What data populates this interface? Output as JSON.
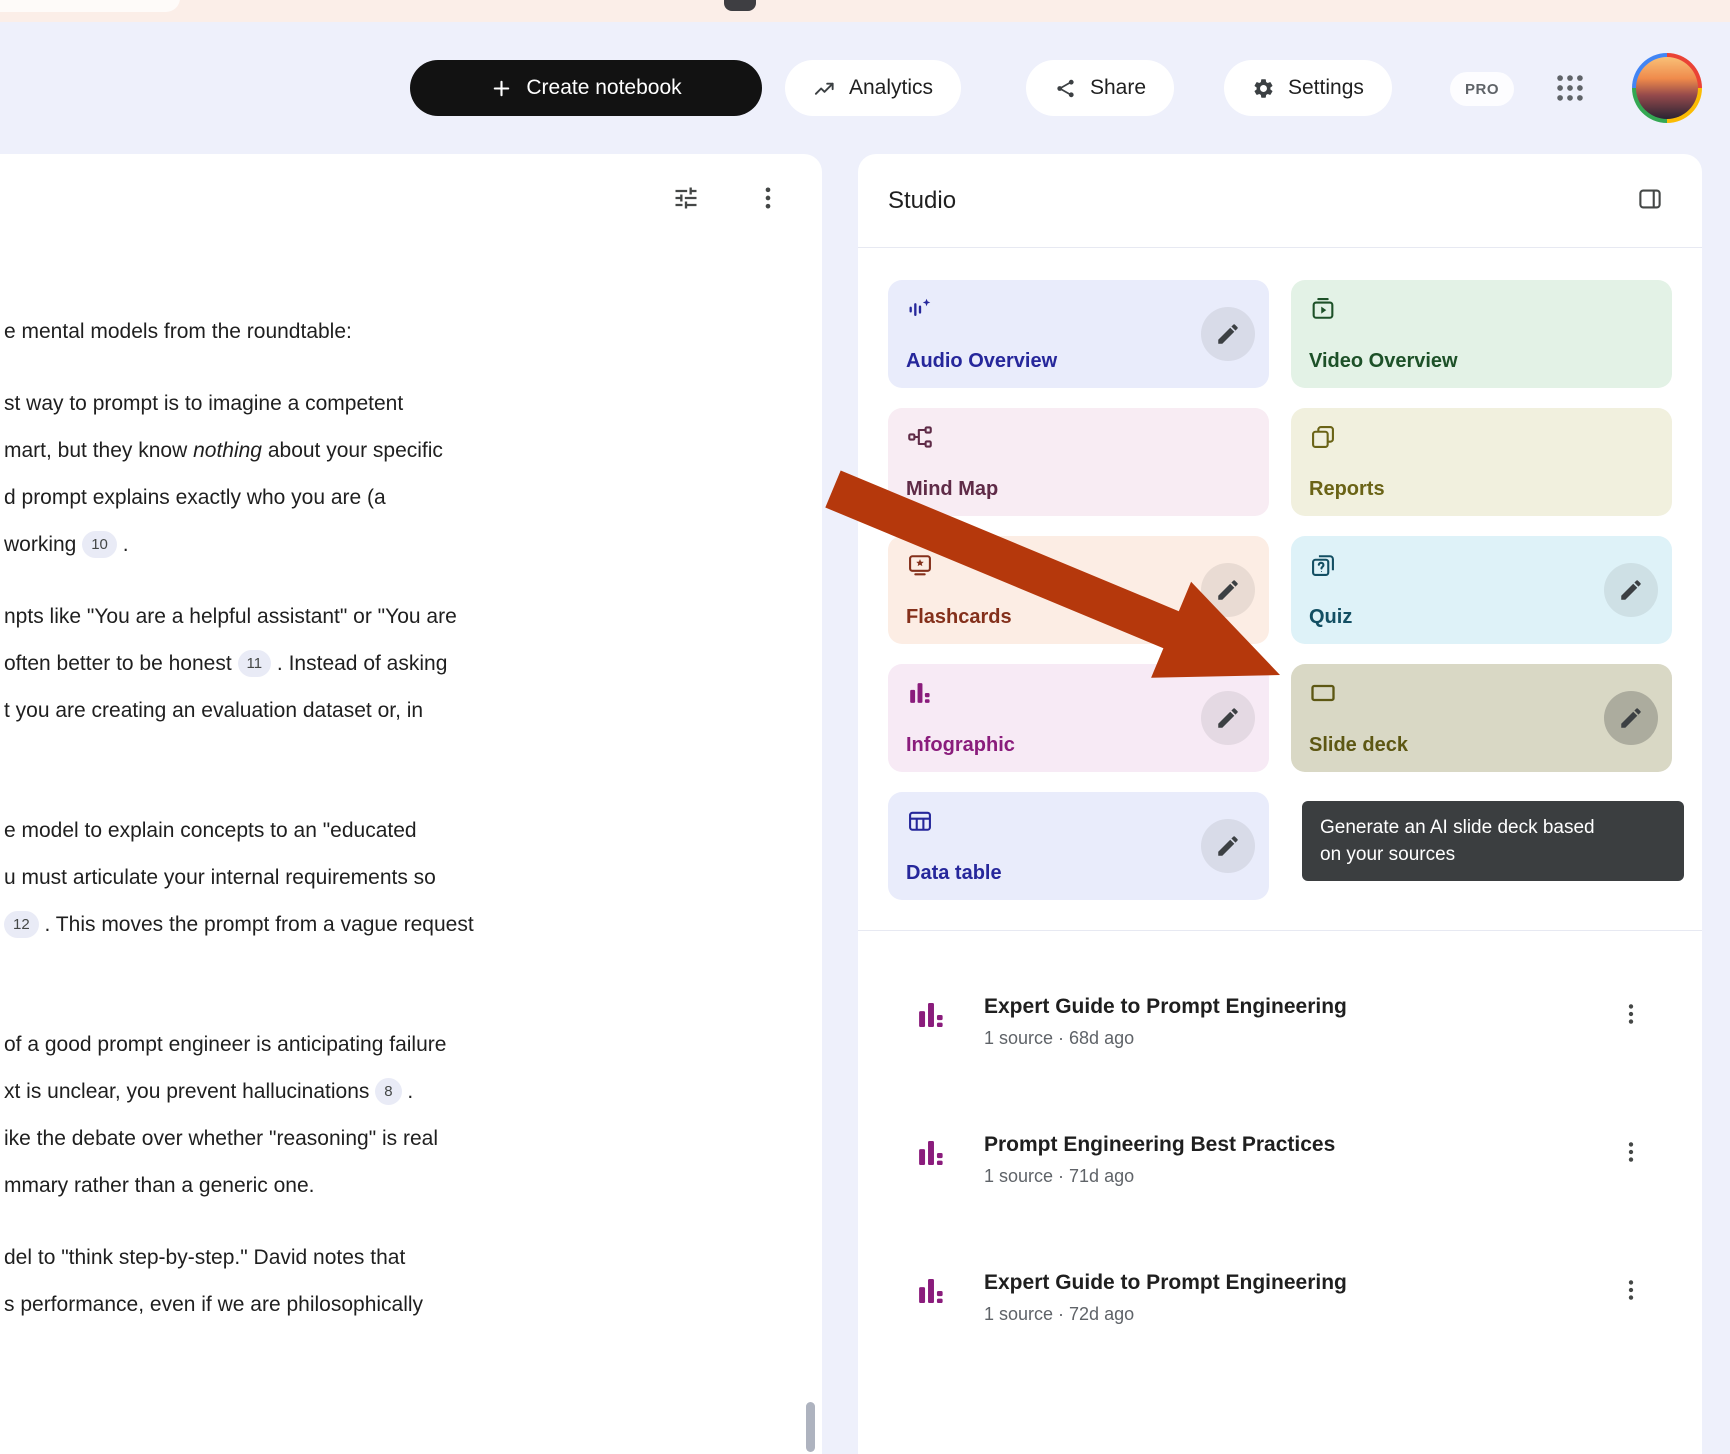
{
  "colors": {
    "page_bg": "#eef0fb",
    "top_strip": "#fbeee8",
    "create_button_bg": "#121212",
    "tooltip_bg": "#3b3e40",
    "list_icon_purple": "#8a1c7c"
  },
  "annotations": {
    "arrow_color": "#b5380c"
  },
  "header": {
    "create_button": "Create notebook",
    "analytics_button": "Analytics",
    "share_button": "Share",
    "settings_button": "Settings",
    "pro_badge": "PRO"
  },
  "document": {
    "paragraphs": [
      {
        "gap": "normal",
        "lines": [
          [
            {
              "type": "text",
              "text": "e mental models from the roundtable:"
            }
          ]
        ]
      },
      {
        "gap": "normal",
        "lines": [
          [
            {
              "type": "text",
              "text": "st way to prompt is to imagine a competent"
            }
          ],
          [
            {
              "type": "text",
              "text": "mart, but they know "
            },
            {
              "type": "italic",
              "text": "nothing"
            },
            {
              "type": "text",
              "text": " about your specific"
            }
          ],
          [
            {
              "type": "text",
              "text": "d prompt explains exactly who you are (a"
            }
          ],
          [
            {
              "type": "text",
              "text": "working "
            },
            {
              "type": "badge",
              "text": "10"
            },
            {
              "type": "text",
              "text": " ."
            }
          ]
        ]
      },
      {
        "gap": "large",
        "lines": [
          [
            {
              "type": "text",
              "text": "npts like \"You are a helpful assistant\" or \"You are"
            }
          ],
          [
            {
              "type": "text",
              "text": "often better to be honest "
            },
            {
              "type": "badge",
              "text": "11"
            },
            {
              "type": "text",
              "text": " . Instead of asking"
            }
          ],
          [
            {
              "type": "text",
              "text": "t you are creating an evaluation dataset or, in"
            }
          ]
        ]
      },
      {
        "gap": "large",
        "lines": [
          [
            {
              "type": "text",
              "text": "e model to explain concepts to an \"educated"
            }
          ],
          [
            {
              "type": "text",
              "text": "u must articulate your internal requirements so"
            }
          ],
          [
            {
              "type": "badge",
              "text": "12"
            },
            {
              "type": "text",
              "text": " . This moves the prompt from a vague request"
            }
          ]
        ]
      },
      {
        "gap": "normal",
        "lines": [
          [
            {
              "type": "text",
              "text": "of a good prompt engineer is anticipating failure"
            }
          ],
          [
            {
              "type": "text",
              "text": "xt is unclear, you prevent hallucinations "
            },
            {
              "type": "badge",
              "text": "8"
            },
            {
              "type": "text",
              "text": " ."
            }
          ],
          [
            {
              "type": "text",
              "text": "ike the debate over whether \"reasoning\" is real"
            }
          ],
          [
            {
              "type": "text",
              "text": "mmary rather than a generic one."
            }
          ]
        ]
      },
      {
        "gap": "normal",
        "lines": [
          [
            {
              "type": "text",
              "text": "del to \"think step-by-step.\" David notes that"
            }
          ],
          [
            {
              "type": "text",
              "text": "s performance, even if we are philosophically"
            }
          ]
        ]
      }
    ]
  },
  "studio": {
    "title": "Studio",
    "cards": [
      {
        "label": "Audio Overview",
        "icon": "audio-waveform-icon",
        "bg": "#e9ecfb",
        "fg": "#26279b",
        "edit": true
      },
      {
        "label": "Video Overview",
        "icon": "video-overview-icon",
        "bg": "#e3f2e6",
        "fg": "#1d5128",
        "edit": false
      },
      {
        "label": "Mind Map",
        "icon": "mind-map-icon",
        "bg": "#f8ecf3",
        "fg": "#5f2b47",
        "edit": false
      },
      {
        "label": "Reports",
        "icon": "reports-icon",
        "bg": "#f1f0de",
        "fg": "#6a6316",
        "edit": false
      },
      {
        "label": "Flashcards",
        "icon": "flashcards-icon",
        "bg": "#fcede4",
        "fg": "#84301b",
        "edit": true
      },
      {
        "label": "Quiz",
        "icon": "quiz-icon",
        "bg": "#def2f8",
        "fg": "#134f63",
        "edit": true
      },
      {
        "label": "Infographic",
        "icon": "infographic-icon",
        "bg": "#f7eaf5",
        "fg": "#8a1c7c",
        "edit": true
      },
      {
        "label": "Slide deck",
        "icon": "slide-deck-icon",
        "bg": "#d9d8c5",
        "fg": "#5d5713",
        "edit": true,
        "highlighted": true
      },
      {
        "label": "Data table",
        "icon": "data-table-icon",
        "bg": "#e9ecfb",
        "fg": "#26279b",
        "edit": true
      }
    ],
    "tooltip_lines": [
      "Generate an AI slide deck based",
      "on your sources"
    ],
    "items": [
      {
        "icon": "infographic-icon",
        "icon_color": "#8a1c7c",
        "title": "Expert Guide to Prompt Engineering",
        "meta": "1 source · 68d ago"
      },
      {
        "icon": "infographic-icon",
        "icon_color": "#8a1c7c",
        "title": "Prompt Engineering Best Practices",
        "meta": "1 source · 71d ago"
      },
      {
        "icon": "infographic-icon",
        "icon_color": "#8a1c7c",
        "title": "Expert Guide to Prompt Engineering",
        "meta": "1 source · 72d ago"
      }
    ]
  }
}
